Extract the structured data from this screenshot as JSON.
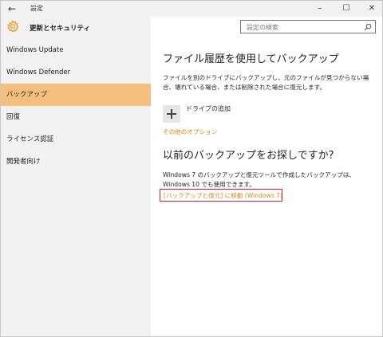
{
  "window": {
    "title": "設定",
    "back_glyph": "←",
    "minimize_glyph": "–",
    "maximize_glyph": "☐",
    "close_glyph": "✕"
  },
  "header": {
    "title": "更新とセキュリティ",
    "icon": "gear-icon",
    "accent_color": "#e89b2a"
  },
  "search": {
    "placeholder": "設定の検索",
    "icon": "search-icon"
  },
  "sidebar": {
    "items": [
      {
        "label": "Windows Update",
        "active": false
      },
      {
        "label": "Windows Defender",
        "active": false
      },
      {
        "label": "バックアップ",
        "active": true
      },
      {
        "label": "回復",
        "active": false
      },
      {
        "label": "ライセンス認証",
        "active": false
      },
      {
        "label": "開発者向け",
        "active": false
      }
    ],
    "active_color": "#f5c07e"
  },
  "main": {
    "section1_title": "ファイル履歴を使用してバックアップ",
    "section1_desc": "ファイルを別のドライブにバックアップし、元のファイルが見つからない場合、壊れている場合、または削除された場合に復元します。",
    "add_drive_label": "ドライブの追加",
    "more_options_link": "その他のオプション",
    "section2_title": "以前のバックアップをお探しですか?",
    "section2_desc": "Windows 7 のバックアップと復元ツールで作成したバックアップは、Windows 10 でも使用できます。",
    "restore_link": "[バックアップと復元] に移動 (Windows 7)",
    "link_color": "#d08a16",
    "highlight_color": "#d02030"
  }
}
